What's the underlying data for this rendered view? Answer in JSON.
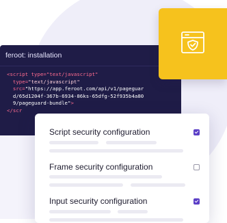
{
  "code_panel": {
    "title": "feroot: installation",
    "line1": "<script type=\"text/javascript\"",
    "line2_attr": "type=",
    "line2_val": "\"text/javascript\"",
    "line3_attr": "src=",
    "line3_val": "\"https://app.feroot.com/api/v1/pageguar",
    "line4": "d/65d1204f-367b-6934-86ks-65dfg-52f935b4a80",
    "line5_val": "9/pageguard-bundle\"",
    "line5_end": ">",
    "line6": "</scr"
  },
  "badge": {
    "icon": "shield-check-window-icon",
    "color": "#f6c21d"
  },
  "settings": [
    {
      "label": "Script security configuration",
      "enabled": true
    },
    {
      "label": "Frame security configuration",
      "enabled": false
    },
    {
      "label": "Input security configuration",
      "enabled": true
    }
  ],
  "colors": {
    "accent": "#5b3fc6",
    "code_bg": "#1f1c47",
    "code_keyword": "#ff6c8f"
  }
}
